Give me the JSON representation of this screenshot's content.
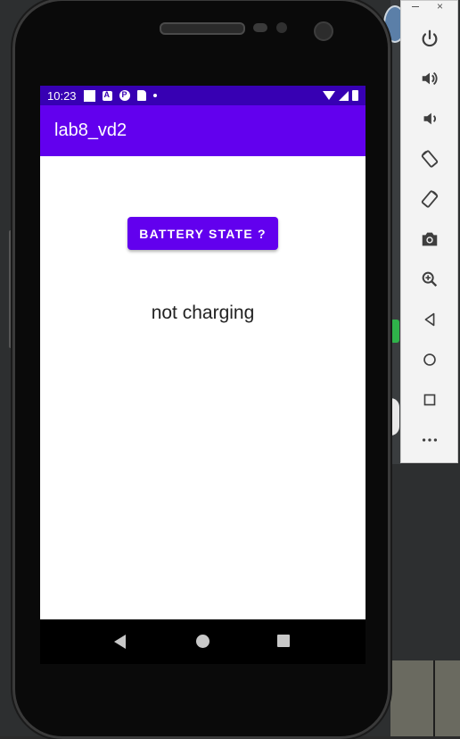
{
  "status_bar": {
    "time": "10:23"
  },
  "app_bar": {
    "title": "lab8_vd2"
  },
  "main": {
    "button_label": "BATTERY STATE ?",
    "status_text": "not charging"
  },
  "toolbar": {
    "items": [
      "power-icon",
      "volume-up-icon",
      "volume-down-icon",
      "rotate-left-icon",
      "rotate-right-icon",
      "camera-icon",
      "zoom-icon",
      "back-icon",
      "home-icon",
      "overview-icon",
      "more-icon"
    ],
    "minimize": "–",
    "close": "×"
  },
  "colors": {
    "status_bar": "#3700b3",
    "primary": "#6200ee",
    "background": "#ffffff"
  }
}
